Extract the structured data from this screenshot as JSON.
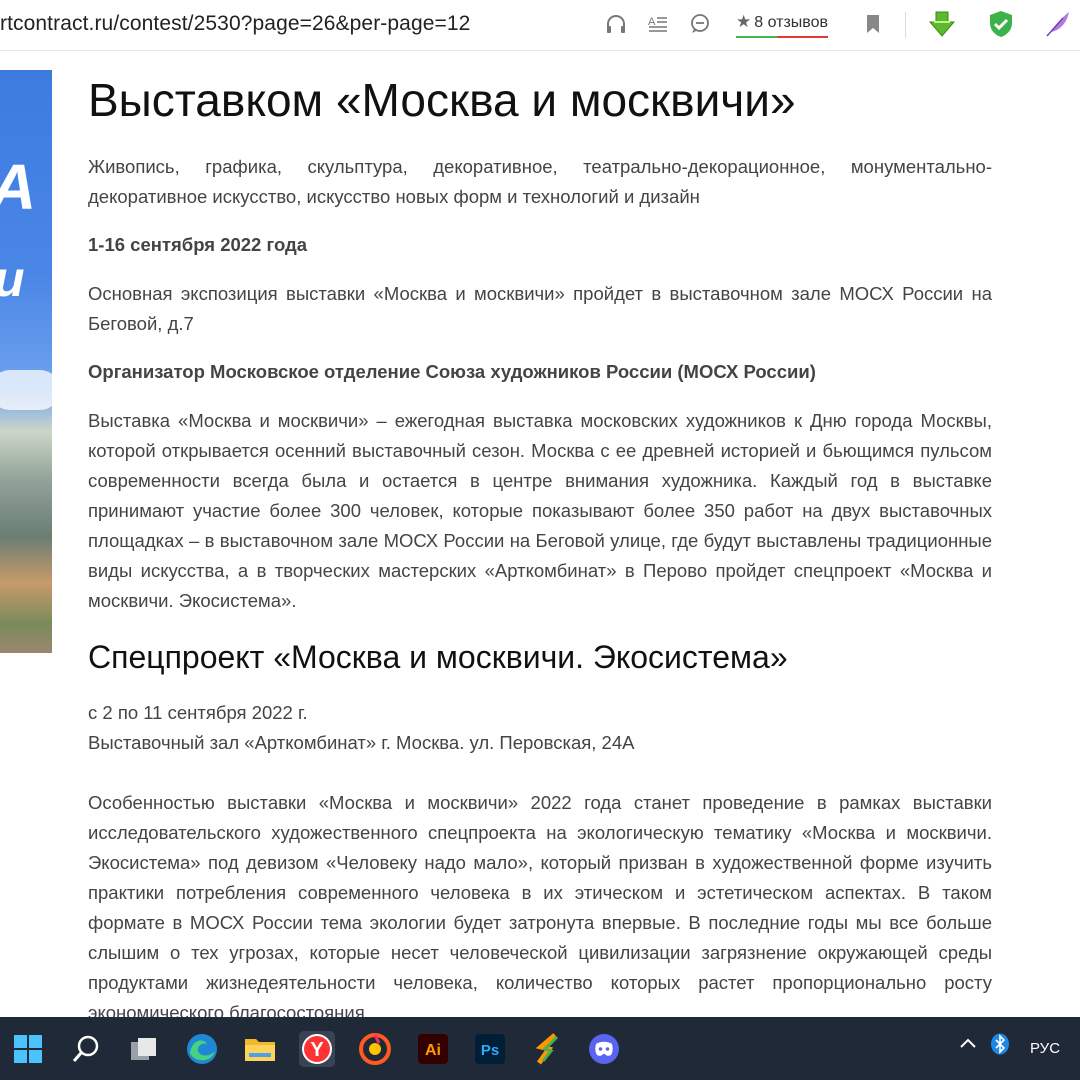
{
  "browser": {
    "url": "rtcontract.ru/contest/2530?page=26&per-page=12",
    "reviews": "8 отзывов",
    "icons": [
      "headphones-icon",
      "reader-icon",
      "chat-icon",
      "star-icon",
      "bookmark-icon",
      "download-icon",
      "shield-icon",
      "feather-icon"
    ]
  },
  "banner": {
    "letters_1": "А",
    "letters_2": "и"
  },
  "article": {
    "title": "Выставком «Москва и москвичи»",
    "subtitle": "Живопись, графика, скульптура, декоративное, театрально-декорационное, монументально-декоративное искусство, искусство новых форм и технологий и дизайн",
    "dates": "1-16 сентября 2022 года",
    "main_exposition": "Основная экспозиция выставки «Москва и москвичи» пройдет в выставочном зале МОСХ России на Беговой, д.7",
    "organizer": "Организатор Московское отделение Союза художников России (МОСХ России)",
    "description": "Выставка «Москва и москвичи» – ежегодная выставка московских художников к Дню города Москвы, которой открывается осенний выставочный сезон. Москва с ее древней историей и бьющимся пульсом современности всегда была и остается в центре внимания художника. Каждый год в выставке принимают участие более 300 человек, которые показывают более 350 работ на двух выставочных площадках – в выставочном зале МОСХ России на Беговой улице, где будут выставлены традиционные виды искусства, а в творческих мастерских «Арткомбинат» в Перово пройдет спецпроект «Москва и москвичи. Экосистема».",
    "section_title": "Спецпроект «Москва и москвичи. Экосистема»",
    "section_dates": "с 2 по 11 сентября 2022 г.",
    "section_place": "Выставочный зал «Арткомбинат» г. Москва. ул. Перовская, 24А",
    "section_text": "Особенностью выставки «Москва и москвичи» 2022 года станет проведение в рамках выставки исследовательского художественного спецпроекта на экологическую тематику «Москва и москвичи. Экосистема» под девизом «Человеку надо мало», который призван в художественной форме изучить практики потребления современного человека в их этическом и эстетическом аспектах. В таком формате в МОСХ России тема экологии будет затронута впервые.  В последние годы мы все больше слышим о тех угрозах, которые несет человеческой цивилизации загрязнение окружающей среды продуктами жизнедеятельности человека, количество которых растет пропорционально росту экономического благосостояния"
  },
  "taskbar": {
    "apps": [
      "windows-start-icon",
      "search-icon",
      "task-view-icon",
      "edge-icon",
      "file-explorer-icon",
      "yandex-browser-icon",
      "music-app-icon",
      "illustrator-icon",
      "photoshop-icon",
      "app-icon",
      "discord-icon"
    ],
    "illustrator_label": "Ai",
    "photoshop_label": "Ps",
    "yandex_label": "Y",
    "language": "РУС"
  }
}
